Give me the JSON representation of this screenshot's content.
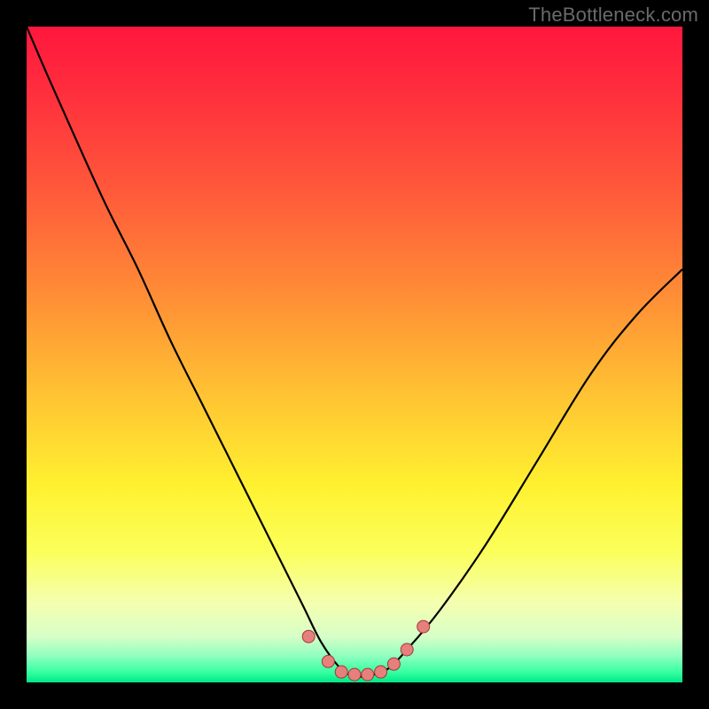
{
  "watermark": "TheBottleneck.com",
  "colors": {
    "frame": "#000000",
    "curve": "#000000",
    "markers_fill": "#e77f7c",
    "markers_stroke": "#a03b3a",
    "gradient_stops": [
      {
        "offset": 0.0,
        "color": "#ff173d"
      },
      {
        "offset": 0.1,
        "color": "#ff2e3d"
      },
      {
        "offset": 0.25,
        "color": "#ff593a"
      },
      {
        "offset": 0.4,
        "color": "#ff8a36"
      },
      {
        "offset": 0.55,
        "color": "#ffbf33"
      },
      {
        "offset": 0.7,
        "color": "#fff130"
      },
      {
        "offset": 0.8,
        "color": "#fbff5a"
      },
      {
        "offset": 0.88,
        "color": "#f4ffb0"
      },
      {
        "offset": 0.93,
        "color": "#d7ffc7"
      },
      {
        "offset": 0.96,
        "color": "#8effc0"
      },
      {
        "offset": 0.985,
        "color": "#34ffa0"
      },
      {
        "offset": 1.0,
        "color": "#00e786"
      }
    ]
  },
  "chart_data": {
    "type": "line",
    "title": "",
    "xlabel": "",
    "ylabel": "",
    "xlim": [
      0,
      100
    ],
    "ylim": [
      0,
      100
    ],
    "x": [
      0,
      3,
      7,
      12,
      17,
      22,
      27,
      32,
      37,
      42,
      45,
      48,
      50,
      52,
      55,
      58,
      63,
      70,
      78,
      86,
      93,
      100
    ],
    "y": [
      100,
      93,
      84,
      73,
      63,
      52,
      42,
      32,
      22,
      12,
      6,
      2,
      1,
      1,
      2,
      5,
      11,
      21,
      34,
      47,
      56,
      63
    ],
    "markers": {
      "x": [
        43,
        46,
        48,
        50,
        52,
        54,
        56,
        58,
        60.5
      ],
      "y": [
        7,
        3.2,
        1.6,
        1.2,
        1.2,
        1.6,
        2.8,
        5.0,
        8.5
      ]
    }
  }
}
